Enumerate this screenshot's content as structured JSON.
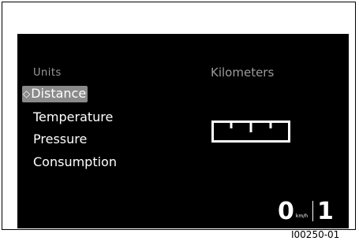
{
  "menu": {
    "heading": "Units",
    "selected_marker": "◇",
    "items": [
      {
        "label": "Distance",
        "selected": true
      },
      {
        "label": "Temperature",
        "selected": false
      },
      {
        "label": "Pressure",
        "selected": false
      },
      {
        "label": "Consumption",
        "selected": false
      }
    ]
  },
  "value_panel": {
    "label": "Kilometers",
    "icon": "ruler-icon"
  },
  "speed_display": {
    "speed": "0",
    "unit": "km/h",
    "gear": "1"
  },
  "reference_code": "I00250-01",
  "colors": {
    "screen_bg": "#000000",
    "text": "#ffffff",
    "muted_text": "#9a9a9a",
    "selected_bg": "#8a8a8a"
  }
}
